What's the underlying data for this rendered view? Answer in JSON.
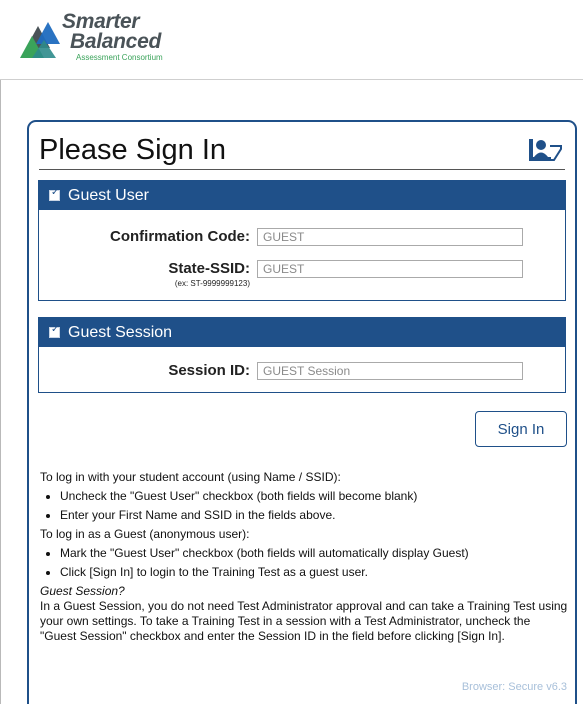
{
  "branding": {
    "name_line1": "Smarter",
    "name_line2": "Balanced",
    "tagline": "Assessment Consortium",
    "colors": {
      "blue": "#1f6bbf",
      "green": "#3aa35a",
      "gray": "#4a5358"
    }
  },
  "signin_panel": {
    "title": "Please Sign In",
    "icon": "user-card-icon",
    "accent_color": "#1f5089",
    "guest_user": {
      "checkbox_label": "Guest User",
      "checked": true,
      "confirmation_code": {
        "label": "Confirmation Code:",
        "value": "GUEST"
      },
      "state_ssid": {
        "label": "State-SSID:",
        "hint": "(ex: ST-9999999123)",
        "value": "GUEST"
      }
    },
    "guest_session": {
      "checkbox_label": "Guest Session",
      "checked": true,
      "session_id": {
        "label": "Session ID:",
        "value": "GUEST Session"
      }
    },
    "signin_button": "Sign In"
  },
  "instructions": {
    "student_intro": "To log in with your student account (using Name / SSID):",
    "student_steps": [
      "Uncheck the \"Guest User\" checkbox (both fields will become blank)",
      "Enter your First Name and SSID in the fields above."
    ],
    "guest_intro": "To log in as a Guest (anonymous user):",
    "guest_steps": [
      "Mark the \"Guest User\" checkbox (both fields will automatically display Guest)",
      "Click [Sign In] to login to the Training Test as a guest user."
    ],
    "session_title": "Guest Session?",
    "session_text": "In a Guest Session, you do not need Test Administrator approval and can take a Training Test using your own settings. To take a Training Test in a session with a Test Administrator, uncheck the \"Guest Session\" checkbox and enter the Session ID in the field before clicking [Sign In]."
  },
  "version": "Browser: Secure v6.3"
}
